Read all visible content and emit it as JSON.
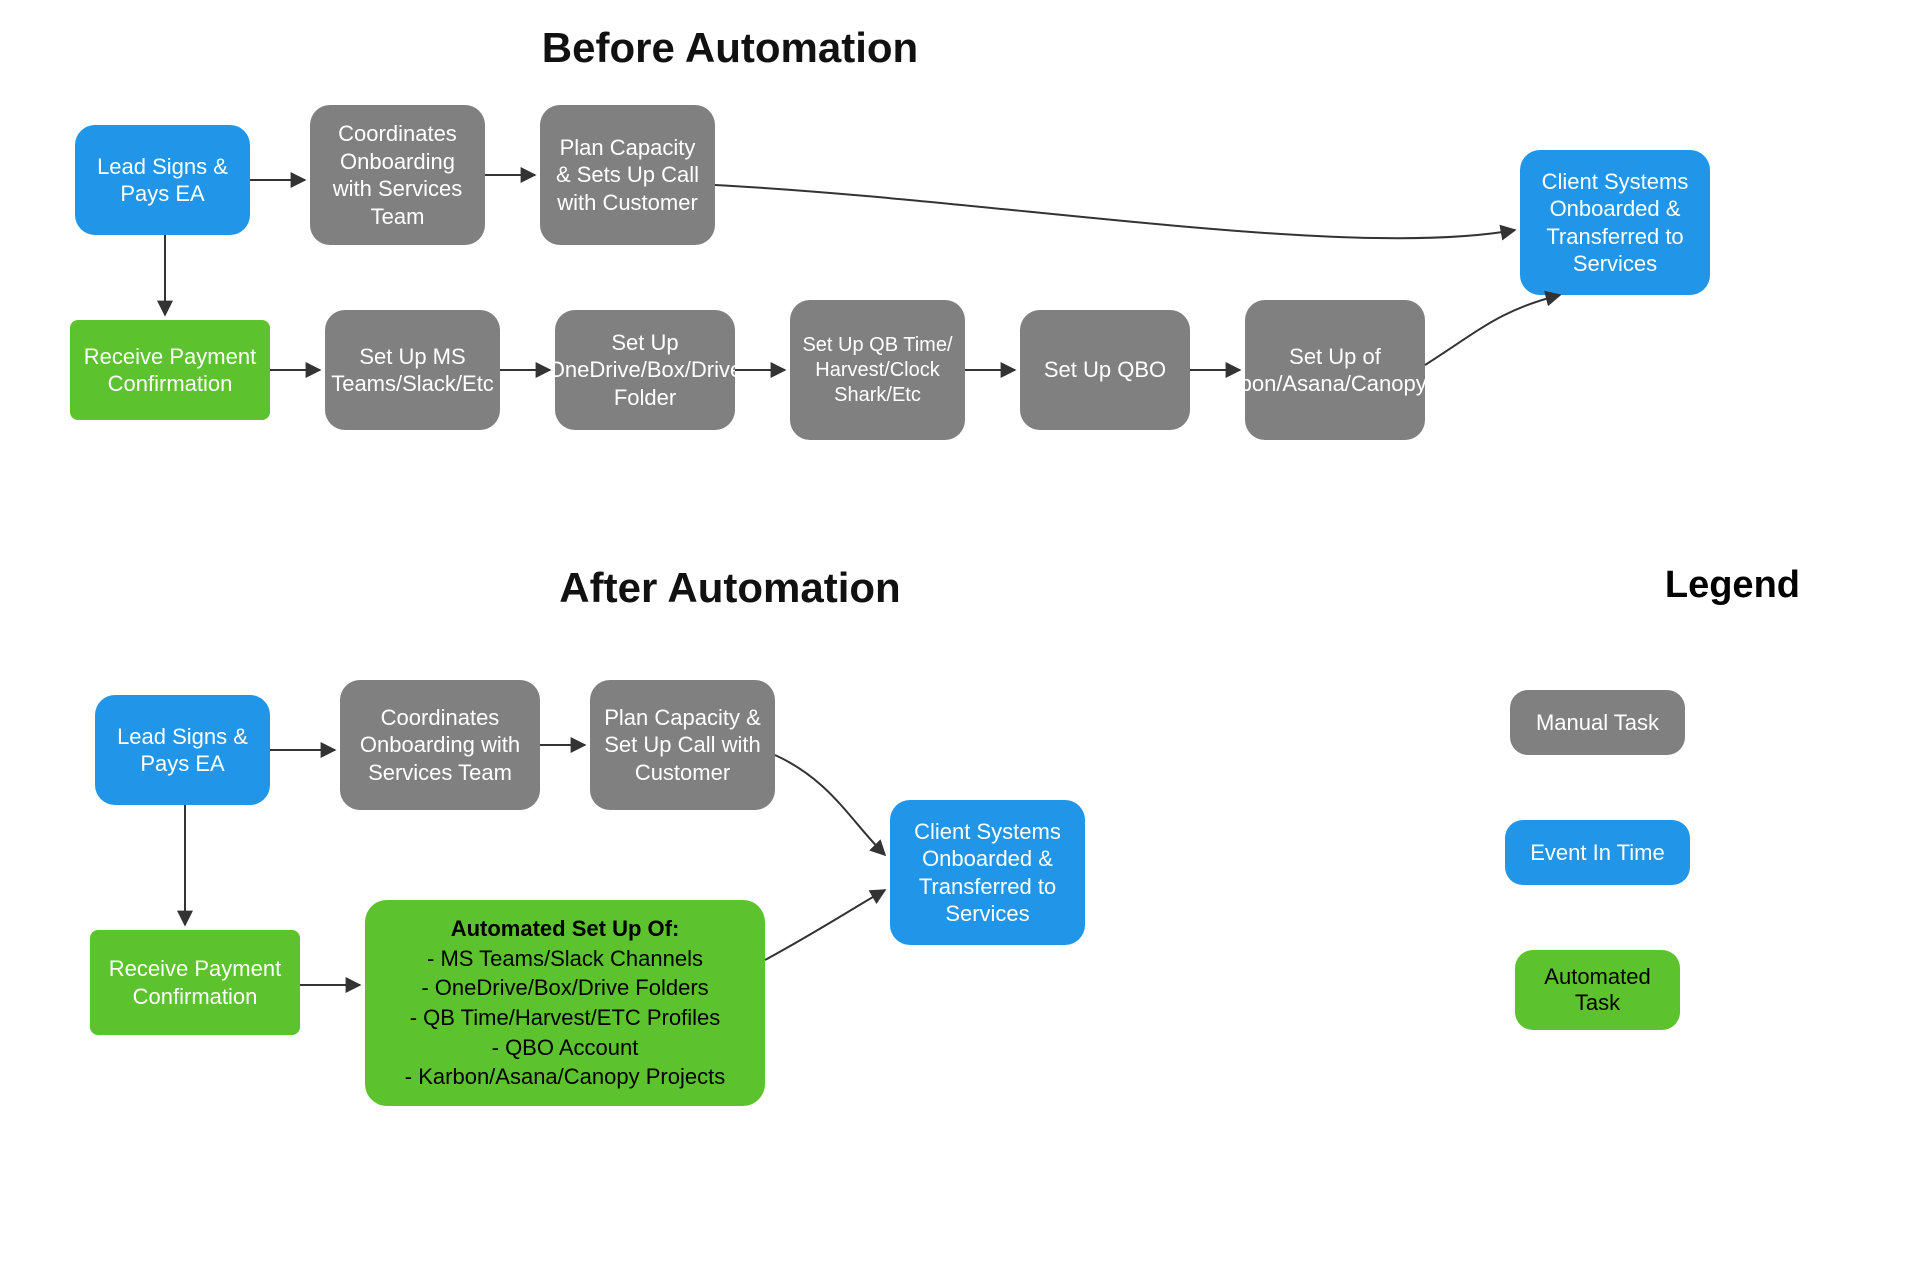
{
  "titles": {
    "before": "Before Automation",
    "after": "After Automation",
    "legend": "Legend"
  },
  "before": {
    "lead": "Lead Signs & Pays EA",
    "coord": "Coordinates Onboarding with Services Team",
    "plan": "Plan Capacity & Sets Up Call with Customer",
    "final": "Client Systems Onboarded & Transferred to Services",
    "receive": "Receive Payment Confirmation",
    "ms": "Set Up MS Teams/Slack/Etc",
    "drive": "Set Up OneDrive/Box/Drive Folder",
    "qbtime": "Set Up QB Time/ Harvest/Clock Shark/Etc",
    "qbo": "Set Up QBO",
    "karbon": "Set Up of Karbon/Asana/Canopy/Etc"
  },
  "after": {
    "lead": "Lead Signs & Pays EA",
    "coord": "Coordinates Onboarding with Services Team",
    "plan": "Plan Capacity & Set Up Call with Customer",
    "final": "Client Systems Onboarded & Transferred to Services",
    "receive": "Receive Payment Confirmation",
    "auto_hdr": "Automated Set Up Of:",
    "auto_l1": "- MS Teams/Slack Channels",
    "auto_l2": "- OneDrive/Box/Drive Folders",
    "auto_l3": "- QB Time/Harvest/ETC Profiles",
    "auto_l4": "- QBO Account",
    "auto_l5": "- Karbon/Asana/Canopy Projects"
  },
  "legend": {
    "manual": "Manual Task",
    "event": "Event In Time",
    "auto": "Automated Task"
  },
  "colors": {
    "gray": "#808080",
    "blue": "#2196e8",
    "green": "#5cc22d"
  }
}
